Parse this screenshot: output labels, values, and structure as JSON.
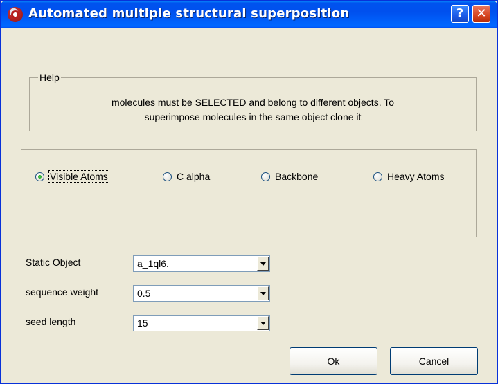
{
  "window": {
    "title": "Automated multiple structural superposition",
    "help_button": "?",
    "close_button": "✕"
  },
  "help_group": {
    "legend": "Help",
    "line1": "molecules must be SELECTED and belong to different objects. To",
    "line2": "superimpose molecules in the same object clone it"
  },
  "atom_options": [
    {
      "label": "Visible Atoms",
      "checked": true
    },
    {
      "label": "C alpha",
      "checked": false
    },
    {
      "label": "Backbone",
      "checked": false
    },
    {
      "label": "Heavy Atoms",
      "checked": false
    }
  ],
  "fields": {
    "static_object": {
      "label": "Static Object",
      "value": "a_1ql6."
    },
    "sequence_weight": {
      "label": "sequence weight",
      "value": "0.5"
    },
    "seed_length": {
      "label": "seed length",
      "value": "15"
    }
  },
  "buttons": {
    "ok": "Ok",
    "cancel": "Cancel"
  },
  "colors": {
    "titlebar": "#0053ee",
    "dialog_bg": "#ece9d8",
    "radio_selected": "#21a121"
  }
}
